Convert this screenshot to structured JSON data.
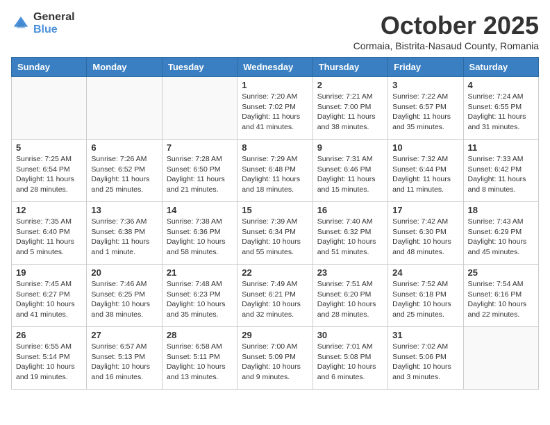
{
  "header": {
    "logo_general": "General",
    "logo_blue": "Blue",
    "month_title": "October 2025",
    "subtitle": "Cormaia, Bistrita-Nasaud County, Romania"
  },
  "days_of_week": [
    "Sunday",
    "Monday",
    "Tuesday",
    "Wednesday",
    "Thursday",
    "Friday",
    "Saturday"
  ],
  "weeks": [
    [
      {
        "day": "",
        "info": ""
      },
      {
        "day": "",
        "info": ""
      },
      {
        "day": "",
        "info": ""
      },
      {
        "day": "1",
        "info": "Sunrise: 7:20 AM\nSunset: 7:02 PM\nDaylight: 11 hours and 41 minutes."
      },
      {
        "day": "2",
        "info": "Sunrise: 7:21 AM\nSunset: 7:00 PM\nDaylight: 11 hours and 38 minutes."
      },
      {
        "day": "3",
        "info": "Sunrise: 7:22 AM\nSunset: 6:57 PM\nDaylight: 11 hours and 35 minutes."
      },
      {
        "day": "4",
        "info": "Sunrise: 7:24 AM\nSunset: 6:55 PM\nDaylight: 11 hours and 31 minutes."
      }
    ],
    [
      {
        "day": "5",
        "info": "Sunrise: 7:25 AM\nSunset: 6:54 PM\nDaylight: 11 hours and 28 minutes."
      },
      {
        "day": "6",
        "info": "Sunrise: 7:26 AM\nSunset: 6:52 PM\nDaylight: 11 hours and 25 minutes."
      },
      {
        "day": "7",
        "info": "Sunrise: 7:28 AM\nSunset: 6:50 PM\nDaylight: 11 hours and 21 minutes."
      },
      {
        "day": "8",
        "info": "Sunrise: 7:29 AM\nSunset: 6:48 PM\nDaylight: 11 hours and 18 minutes."
      },
      {
        "day": "9",
        "info": "Sunrise: 7:31 AM\nSunset: 6:46 PM\nDaylight: 11 hours and 15 minutes."
      },
      {
        "day": "10",
        "info": "Sunrise: 7:32 AM\nSunset: 6:44 PM\nDaylight: 11 hours and 11 minutes."
      },
      {
        "day": "11",
        "info": "Sunrise: 7:33 AM\nSunset: 6:42 PM\nDaylight: 11 hours and 8 minutes."
      }
    ],
    [
      {
        "day": "12",
        "info": "Sunrise: 7:35 AM\nSunset: 6:40 PM\nDaylight: 11 hours and 5 minutes."
      },
      {
        "day": "13",
        "info": "Sunrise: 7:36 AM\nSunset: 6:38 PM\nDaylight: 11 hours and 1 minute."
      },
      {
        "day": "14",
        "info": "Sunrise: 7:38 AM\nSunset: 6:36 PM\nDaylight: 10 hours and 58 minutes."
      },
      {
        "day": "15",
        "info": "Sunrise: 7:39 AM\nSunset: 6:34 PM\nDaylight: 10 hours and 55 minutes."
      },
      {
        "day": "16",
        "info": "Sunrise: 7:40 AM\nSunset: 6:32 PM\nDaylight: 10 hours and 51 minutes."
      },
      {
        "day": "17",
        "info": "Sunrise: 7:42 AM\nSunset: 6:30 PM\nDaylight: 10 hours and 48 minutes."
      },
      {
        "day": "18",
        "info": "Sunrise: 7:43 AM\nSunset: 6:29 PM\nDaylight: 10 hours and 45 minutes."
      }
    ],
    [
      {
        "day": "19",
        "info": "Sunrise: 7:45 AM\nSunset: 6:27 PM\nDaylight: 10 hours and 41 minutes."
      },
      {
        "day": "20",
        "info": "Sunrise: 7:46 AM\nSunset: 6:25 PM\nDaylight: 10 hours and 38 minutes."
      },
      {
        "day": "21",
        "info": "Sunrise: 7:48 AM\nSunset: 6:23 PM\nDaylight: 10 hours and 35 minutes."
      },
      {
        "day": "22",
        "info": "Sunrise: 7:49 AM\nSunset: 6:21 PM\nDaylight: 10 hours and 32 minutes."
      },
      {
        "day": "23",
        "info": "Sunrise: 7:51 AM\nSunset: 6:20 PM\nDaylight: 10 hours and 28 minutes."
      },
      {
        "day": "24",
        "info": "Sunrise: 7:52 AM\nSunset: 6:18 PM\nDaylight: 10 hours and 25 minutes."
      },
      {
        "day": "25",
        "info": "Sunrise: 7:54 AM\nSunset: 6:16 PM\nDaylight: 10 hours and 22 minutes."
      }
    ],
    [
      {
        "day": "26",
        "info": "Sunrise: 6:55 AM\nSunset: 5:14 PM\nDaylight: 10 hours and 19 minutes."
      },
      {
        "day": "27",
        "info": "Sunrise: 6:57 AM\nSunset: 5:13 PM\nDaylight: 10 hours and 16 minutes."
      },
      {
        "day": "28",
        "info": "Sunrise: 6:58 AM\nSunset: 5:11 PM\nDaylight: 10 hours and 13 minutes."
      },
      {
        "day": "29",
        "info": "Sunrise: 7:00 AM\nSunset: 5:09 PM\nDaylight: 10 hours and 9 minutes."
      },
      {
        "day": "30",
        "info": "Sunrise: 7:01 AM\nSunset: 5:08 PM\nDaylight: 10 hours and 6 minutes."
      },
      {
        "day": "31",
        "info": "Sunrise: 7:02 AM\nSunset: 5:06 PM\nDaylight: 10 hours and 3 minutes."
      },
      {
        "day": "",
        "info": ""
      }
    ]
  ]
}
